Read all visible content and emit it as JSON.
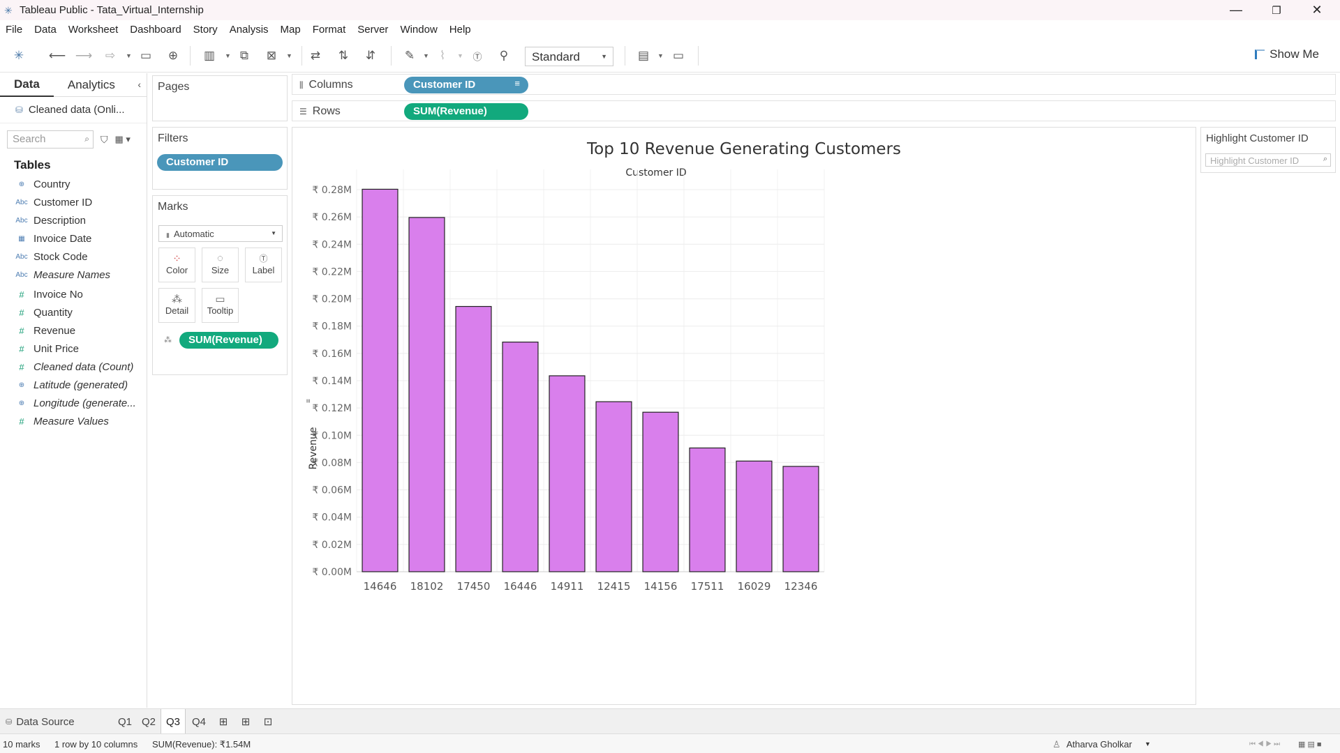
{
  "window": {
    "title": "Tableau Public - Tata_Virtual_Internship",
    "controls": [
      "—",
      "❐",
      "✕"
    ]
  },
  "menu": [
    "File",
    "Data",
    "Worksheet",
    "Dashboard",
    "Story",
    "Analysis",
    "Map",
    "Format",
    "Server",
    "Window",
    "Help"
  ],
  "toolbar": {
    "fit": "Standard",
    "show_me": "Show Me"
  },
  "data_pane": {
    "tabs": [
      "Data",
      "Analytics"
    ],
    "data_source": "Cleaned data (Onli...",
    "search_placeholder": "Search",
    "tables_header": "Tables",
    "dimensions": [
      {
        "icon": "globe-icon",
        "glyph": "⊕",
        "name": "Country",
        "italic": false
      },
      {
        "icon": "abc-icon",
        "glyph": "Abc",
        "name": "Customer ID",
        "italic": false
      },
      {
        "icon": "abc-icon",
        "glyph": "Abc",
        "name": "Description",
        "italic": false
      },
      {
        "icon": "calendar-icon",
        "glyph": "▦",
        "name": "Invoice Date",
        "italic": false
      },
      {
        "icon": "abc-icon",
        "glyph": "Abc",
        "name": "Stock Code",
        "italic": false
      },
      {
        "icon": "abc-icon",
        "glyph": "Abc",
        "name": "Measure Names",
        "italic": true
      }
    ],
    "measures": [
      {
        "icon": "hash-icon",
        "glyph": "#",
        "name": "Invoice No",
        "italic": false
      },
      {
        "icon": "hash-icon",
        "glyph": "#",
        "name": "Quantity",
        "italic": false
      },
      {
        "icon": "hash-icon",
        "glyph": "#",
        "name": "Revenue",
        "italic": false
      },
      {
        "icon": "hash-icon",
        "glyph": "#",
        "name": "Unit Price",
        "italic": false
      },
      {
        "icon": "hash-icon",
        "glyph": "#",
        "name": "Cleaned data (Count)",
        "italic": true
      },
      {
        "icon": "globe-icon",
        "glyph": "⊕",
        "name": "Latitude (generated)",
        "italic": true
      },
      {
        "icon": "globe-icon",
        "glyph": "⊕",
        "name": "Longitude (generate...",
        "italic": true
      },
      {
        "icon": "hash-icon",
        "glyph": "#",
        "name": "Measure Values",
        "italic": true
      }
    ]
  },
  "cards": {
    "pages": "Pages",
    "filters": "Filters",
    "filter_pill": "Customer ID",
    "marks": "Marks",
    "mark_type": "Automatic",
    "mark_buttons": [
      "Color",
      "Size",
      "Label",
      "Detail",
      "Tooltip"
    ],
    "mark_pill": "SUM(Revenue)"
  },
  "shelves": {
    "columns_label": "Columns",
    "columns_pill": "Customer ID",
    "rows_label": "Rows",
    "rows_pill": "SUM(Revenue)"
  },
  "highlight": {
    "title": "Highlight Customer ID",
    "placeholder": "Highlight Customer ID"
  },
  "chart_data": {
    "type": "bar",
    "title": "Top 10 Revenue Generating Customers",
    "xlabel": "Customer ID",
    "ylabel": "Revenue",
    "categories": [
      "14646",
      "18102",
      "17450",
      "16446",
      "14911",
      "12415",
      "14156",
      "17511",
      "16029",
      "12346"
    ],
    "values": [
      0.2803,
      0.2596,
      0.1944,
      0.1683,
      0.1436,
      0.1246,
      0.1169,
      0.0907,
      0.0811,
      0.0772
    ],
    "value_unit": "₹ M",
    "ylim": [
      0,
      0.28
    ],
    "yticks": [
      "₹ 0.00M",
      "₹ 0.02M",
      "₹ 0.04M",
      "₹ 0.06M",
      "₹ 0.08M",
      "₹ 0.10M",
      "₹ 0.12M",
      "₹ 0.14M",
      "₹ 0.16M",
      "₹ 0.18M",
      "₹ 0.20M",
      "₹ 0.22M",
      "₹ 0.24M",
      "₹ 0.26M",
      "₹ 0.28M"
    ],
    "ytick_values": [
      0,
      0.02,
      0.04,
      0.06,
      0.08,
      0.1,
      0.12,
      0.14,
      0.16,
      0.18,
      0.2,
      0.22,
      0.24,
      0.26,
      0.28
    ],
    "bar_color": "#d97fec",
    "grid": true
  },
  "sheet_tabs": {
    "data_source": "Data Source",
    "sheets": [
      "Q1",
      "Q2",
      "Q3",
      "Q4"
    ],
    "active": "Q3"
  },
  "status": {
    "marks": "10 marks",
    "layout": "1 row by 10 columns",
    "sum": "SUM(Revenue): ₹1.54M",
    "user": "Atharva Gholkar"
  }
}
